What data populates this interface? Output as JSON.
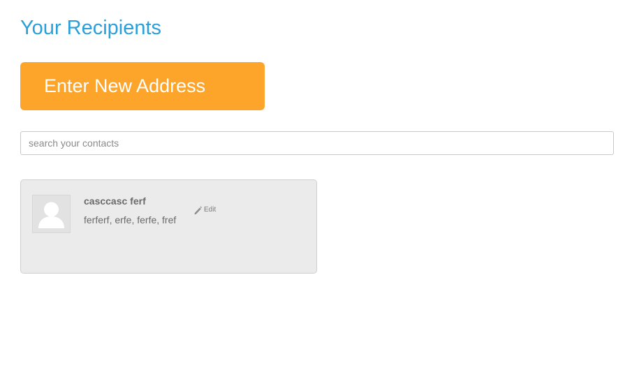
{
  "header": {
    "title": "Your Recipients"
  },
  "actions": {
    "new_address_label": "Enter New Address"
  },
  "search": {
    "placeholder": "search your contacts",
    "value": ""
  },
  "contacts": [
    {
      "name": "casccasc ferf",
      "address": "ferferf, erfe, ferfe, fref",
      "edit_label": "Edit",
      "avatar_icon": "default-avatar-icon",
      "edit_icon": "pencil-icon"
    }
  ],
  "colors": {
    "title": "#2a9fd8",
    "primary_button": "#fda52a",
    "card_background": "#ebebeb"
  }
}
